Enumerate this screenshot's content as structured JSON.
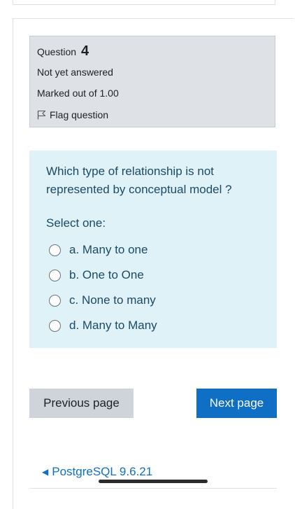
{
  "question_info": {
    "label": "Question",
    "number": "4",
    "state": "Not yet answered",
    "grade": "Marked out of 1.00",
    "flag_label": "Flag question"
  },
  "question": {
    "text": "Which type of relationship is not represented by conceptual model ?",
    "prompt": "Select one:",
    "options": [
      {
        "label": "a. Many to one",
        "selected": false
      },
      {
        "label": "b. One to One",
        "selected": false
      },
      {
        "label": "c. None to many",
        "selected": false
      },
      {
        "label": "d. Many to Many",
        "selected": false
      }
    ]
  },
  "navigation": {
    "prev_label": "Previous page",
    "next_label": "Next page",
    "back_link_label": "PostgreSQL 9.6.21"
  },
  "colors": {
    "info_bg": "#dee2e6",
    "formulation_bg": "#def2f8",
    "formulation_text": "#1c4a66",
    "primary": "#0f6fc5",
    "secondary_btn": "#ced4da"
  }
}
